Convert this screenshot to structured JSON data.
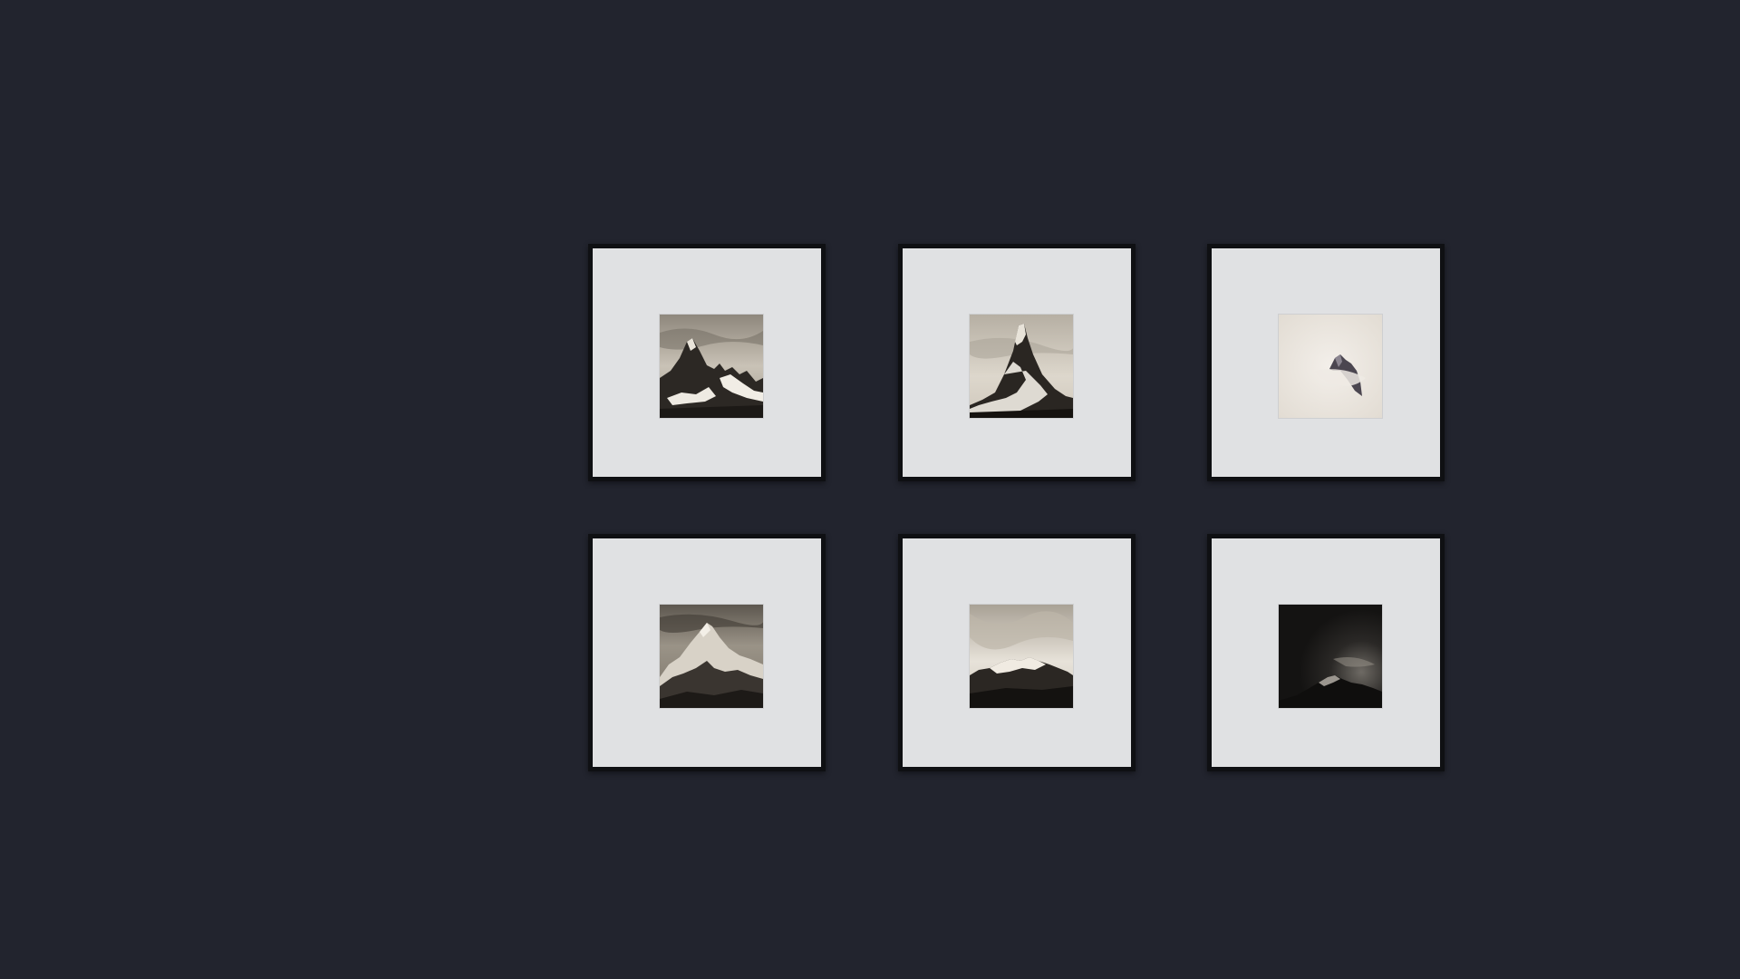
{
  "gallery": {
    "background": "#22242e",
    "frame_color": "#0f1013",
    "mat_color": "#e0e1e3",
    "frames": [
      {
        "subject": "jagged-peak-with-glaciers-photo",
        "tone": "sepia"
      },
      {
        "subject": "pyramidal-peak-matterhorn-photo",
        "tone": "sepia"
      },
      {
        "subject": "peak-in-mist-photo",
        "tone": "light-sepia"
      },
      {
        "subject": "snowy-summit-ridge-photo",
        "tone": "sepia"
      },
      {
        "subject": "snow-capped-massif-under-clouds-photo",
        "tone": "sepia"
      },
      {
        "subject": "dark-sky-mountain-photo",
        "tone": "dark"
      }
    ]
  }
}
